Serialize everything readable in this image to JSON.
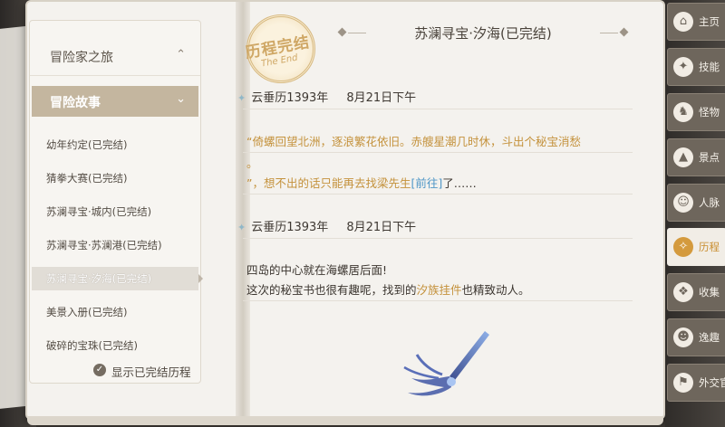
{
  "left_panel": {
    "category": "冒险家之旅",
    "subcategory": "冒险故事",
    "stories": [
      "幼年约定(已完结)",
      "猜拳大赛(已完结)",
      "苏澜寻宝·城内(已完结)",
      "苏澜寻宝·苏澜港(已完结)",
      "苏澜寻宝·汐海(已完结)",
      "美景入册(已完结)",
      "破碎的宝珠(已完结)"
    ],
    "active_story_index": 4,
    "show_completed": "显示已完结历程",
    "show_completed_checked": true
  },
  "seal": {
    "text": "历程完结",
    "sub": "The End"
  },
  "page": {
    "title": "苏澜寻宝·汐海(已完结)",
    "entries": [
      {
        "year": "云垂历1393年",
        "date": "8月21日下午",
        "line1": "“倚螺回望北洲，逐浪繁花依旧。赤艘星潮几时休，斗出个秘宝消愁",
        "line1b": "。",
        "line2_pre": "”，想不出的话只能再去找",
        "line2_name": "梁先生",
        "line2_link": "[前往]",
        "line2_post": "了……"
      },
      {
        "year": "云垂历1393年",
        "date": "8月21日下午",
        "line1": "四岛的中心就在海螺居后面!",
        "line2_pre": "这次的秘宝书也很有趣呢，找到的",
        "line2_item": "汐族挂件",
        "line2_post": "也精致动人。"
      }
    ]
  },
  "nav": [
    {
      "label": "主页",
      "icon": "home-icon",
      "glyph": "⌂"
    },
    {
      "label": "技能",
      "icon": "skill-icon",
      "glyph": "✦"
    },
    {
      "label": "怪物",
      "icon": "monster-icon",
      "glyph": "♞"
    },
    {
      "label": "景点",
      "icon": "scenery-icon",
      "glyph": "▲"
    },
    {
      "label": "人脉",
      "icon": "contacts-icon",
      "glyph": "☺"
    },
    {
      "label": "历程",
      "icon": "journey-icon",
      "glyph": "✧"
    },
    {
      "label": "收集",
      "icon": "collection-icon",
      "glyph": "❖"
    },
    {
      "label": "逸趣",
      "icon": "leisure-icon",
      "glyph": "☻"
    },
    {
      "label": "外交官",
      "icon": "diplomat-icon",
      "glyph": "⚑"
    }
  ],
  "nav_active_index": 5,
  "colors": {
    "accent_gold": "#c4923c",
    "link_blue": "#4f97c7",
    "tab_tan": "#c4b69f"
  }
}
